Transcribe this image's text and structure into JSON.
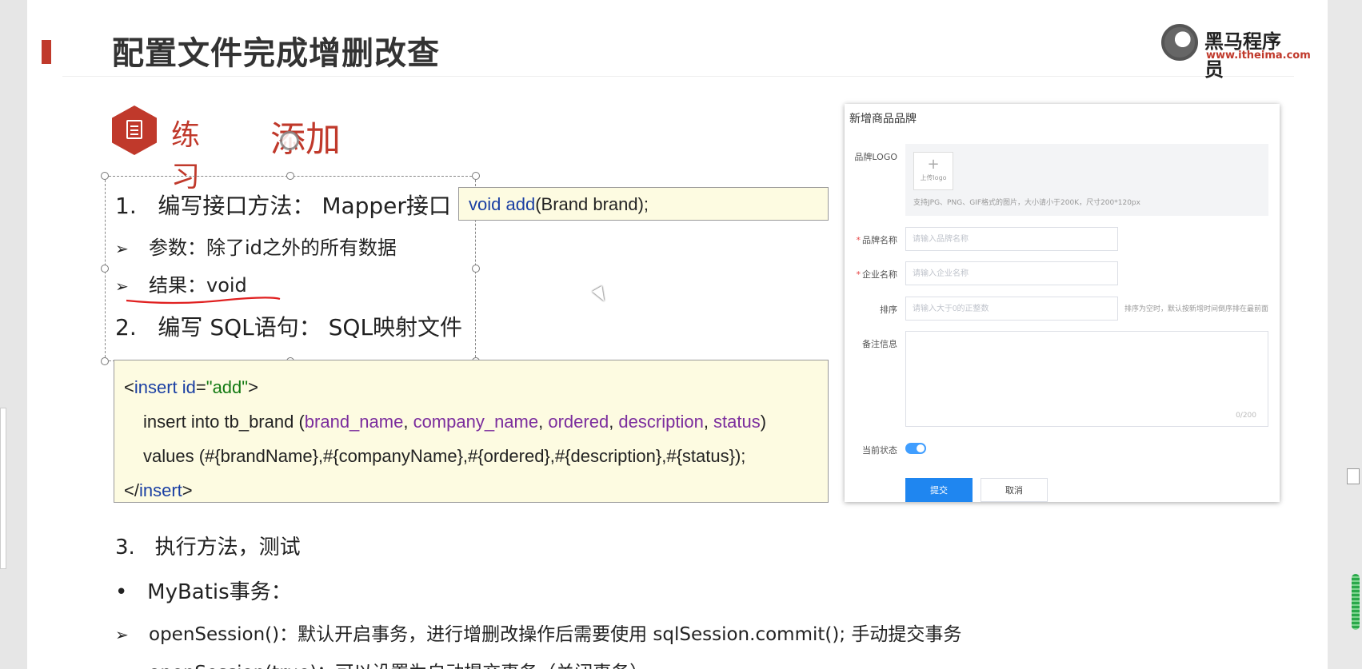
{
  "slide": {
    "title": "配置文件完成增删改查",
    "logo": {
      "name": "黑马程序员",
      "url": "www.itheima.com"
    },
    "practice_label": "练习",
    "add_word": "添加",
    "step1": {
      "num": "1.",
      "text": "编写接口方法： Mapper接口"
    },
    "param_line": "参数：除了id之外的所有数据",
    "result_line": "结果：void",
    "step2": {
      "num": "2.",
      "text": "编写 SQL语句： SQL映射文件"
    },
    "signature": {
      "kw": "void add",
      "rest": "(Brand brand);"
    },
    "xml": {
      "open_lt": "<",
      "open_tag": "insert id",
      "open_eq": "=",
      "open_val": "\"add\"",
      "open_gt": ">",
      "line2_prefix": "insert into tb_brand (",
      "cols": [
        "brand_name",
        "company_name",
        "ordered",
        "description",
        "status"
      ],
      "line2_suffix": ")",
      "line3": "values (#{brandName},#{companyName},#{ordered},#{description},#{status});",
      "close_lt": "</",
      "close_tag": "insert",
      "close_gt": ">"
    },
    "step3": {
      "num": "3.",
      "text": "执行方法，测试"
    },
    "bullet_dot": "•",
    "mybatis_tx": "MyBatis事务：",
    "open_session": "openSession()：默认开启事务，进行增删改操作后需要使用 sqlSession.commit(); 手动提交事务",
    "open_session_true": "openSession(true)：可以设置为自动提交事务（关闭事务）"
  },
  "form": {
    "title": "新增商品品牌",
    "logo_label": "品牌LOGO",
    "upload_plus": "+",
    "upload_text": "上传logo",
    "logo_hint": "支持JPG、PNG、GIF格式的图片，大小请小于200K，尺寸200*120px",
    "required_mark": "*",
    "brand_label": "品牌名称",
    "brand_placeholder": "请输入品牌名称",
    "company_label": "企业名称",
    "company_placeholder": "请输入企业名称",
    "order_label": "排序",
    "order_placeholder": "请输入大于0的正整数",
    "order_hint": "排序为空时，默认按新增时间倒序排在最前面",
    "remark_label": "备注信息",
    "remark_counter": "0/200",
    "status_label": "当前状态",
    "status_on": true,
    "submit": "提交",
    "cancel": "取消"
  },
  "colors": {
    "accent": "#c0392b",
    "keyword": "#1a3fa3",
    "string": "#127a12",
    "attr": "#7b2d9d",
    "primary": "#1f86f0"
  }
}
